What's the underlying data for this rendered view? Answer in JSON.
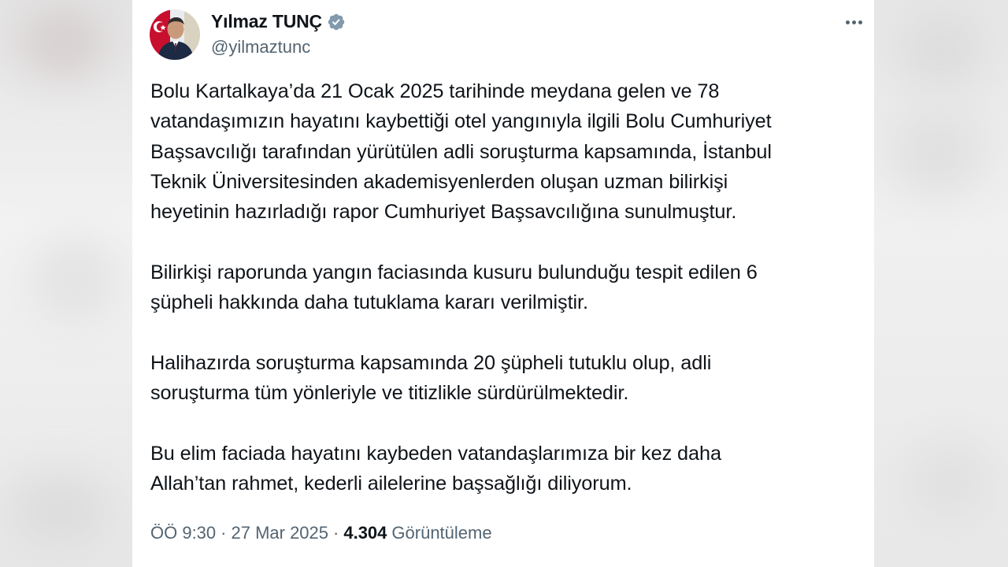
{
  "author": {
    "display_name": "Yılmaz TUNÇ",
    "handle": "@yilmaztunc",
    "verified_icon": "verified-badge-icon",
    "avatar_icon": "avatar-photo"
  },
  "tweet": {
    "paragraphs": [
      "Bolu Kartalkaya’da 21 Ocak 2025 tarihinde meydana gelen ve 78\nvatandaşımızın hayatını kaybettiği otel yangınıyla ilgili Bolu Cumhuriyet\nBaşsavcılığı tarafından yürütülen adli soruşturma kapsamında, İstanbul\nTeknik Üniversitesinden akademisyenlerden oluşan uzman bilirkişi\nheyetinin hazırladığı rapor Cumhuriyet Başsavcılığına sunulmuştur.",
      "Bilirkişi raporunda yangın faciasında kusuru bulunduğu tespit edilen 6\nşüpheli hakkında daha tutuklama kararı verilmiştir.",
      "Halihazırda soruşturma kapsamında 20 şüpheli tutuklu olup, adli\nsoruşturma tüm yönleriyle ve titizlikle sürdürülmektedir.",
      "Bu elim faciada hayatını kaybeden vatandaşlarımıza bir kez daha\nAllah’tan rahmet, kederli ailelerine başsağlığı diliyorum."
    ],
    "time": "ÖÖ 9:30",
    "separator": "·",
    "date": "27 Mar 2025",
    "views_count": "4.304",
    "views_label": "Görüntüleme"
  },
  "more_icon": "more-options-icon",
  "colors": {
    "text_primary": "#0f1419",
    "text_secondary": "#536471",
    "verified_badge": "#829aab",
    "card_background": "#ffffff"
  }
}
